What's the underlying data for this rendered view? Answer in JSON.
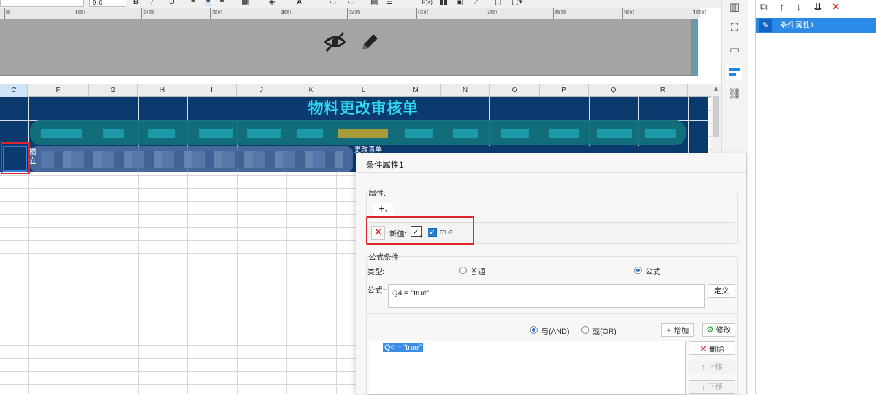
{
  "toolbar": {
    "font_size_value": "9.0",
    "bold_label": "B",
    "italic_label": "I",
    "underline_label": "U",
    "font_color_label": "A",
    "function_label": "F(x)"
  },
  "ruler": {
    "ticks": [
      "0",
      "100",
      "200",
      "300",
      "400",
      "500",
      "600",
      "700",
      "800",
      "900",
      "1000"
    ]
  },
  "header_band": {
    "icons": [
      "hidden-eye-icon",
      "pencil-icon"
    ]
  },
  "columns": [
    "C",
    "F",
    "G",
    "H",
    "I",
    "J",
    "K",
    "L",
    "M",
    "N",
    "O",
    "P",
    "Q",
    "R"
  ],
  "sheet": {
    "title": "物料更改审核单",
    "row3_left_text": "物\n立",
    "row3_fragment": "更改清单"
  },
  "right_panel": {
    "item_label": "条件属性1",
    "toolbar_icons": [
      "copy-icon",
      "move-up-icon",
      "move-down-icon",
      "move-to-bottom-icon",
      "delete-icon"
    ]
  },
  "sidebar_icons": [
    "cell-element-icon",
    "cell-attribute-icon",
    "widget-icon",
    "condition-attribute-icon",
    "hyperlink-icon"
  ],
  "dialog": {
    "title": "条件属性1",
    "properties_label": "属性:",
    "add_button_label": "+",
    "new_value_label": "新值:",
    "checkbox_value": "true",
    "formula_condition_label": "公式条件",
    "type_label": "类型:",
    "type_option_normal": "普通",
    "type_option_formula": "公式",
    "formula_label": "公式=",
    "formula_value": "Q4 = \"true\"",
    "define_button": "定义",
    "and_label": "与(AND)",
    "or_label": "或(OR)",
    "add_label": "增加",
    "modify_label": "修改",
    "delete_label": "删除",
    "move_up_label": "上移",
    "move_down_label": "下移",
    "conditions": [
      "Q4 = \"true\""
    ]
  },
  "colors": {
    "navy": "#0b3a6e",
    "title_cyan": "#2ed8f0",
    "accent_blue": "#2b8ae8",
    "highlight_red": "#e0262b"
  }
}
